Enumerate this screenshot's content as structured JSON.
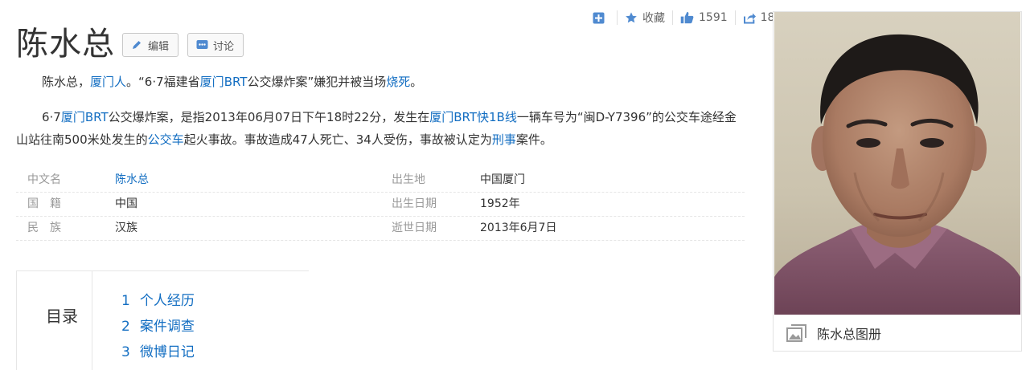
{
  "toolbar": {
    "add_label": "",
    "favorite_label": "收藏",
    "like_count": "1591",
    "share_count": "18"
  },
  "title": "陈水总",
  "buttons": {
    "edit": "编辑",
    "discuss": "讨论"
  },
  "summary": {
    "s1": "陈水总，",
    "l1": "厦门人",
    "s2": "。“6·7福建省",
    "l2": "厦门",
    "l3": "BRT",
    "s3": "公交爆炸案”嫌犯并被当场",
    "l4": "烧死",
    "s4": "。"
  },
  "para2": {
    "s1": "6·7",
    "l1": "厦门",
    "l2": "BRT",
    "s2": "公交爆炸案，是指2013年06月07日下午18时22分，发生在",
    "l3": "厦门BRT快1B线",
    "s3": "一辆车号为“闽D-Y7396”的公交车途经金山站往南500米处发生的",
    "l4": "公交车",
    "s4": "起火事故。事故造成47人死亡、34人受伤，事故被认定为",
    "l5": "刑事",
    "s5": "案件。"
  },
  "info": [
    {
      "label": "中文名",
      "value": "陈水总",
      "label2": "出生地",
      "value2": "中国厦门"
    },
    {
      "label": "国　籍",
      "value": "中国",
      "label2": "出生日期",
      "value2": "1952年"
    },
    {
      "label": "民　族",
      "value": "汉族",
      "label2": "逝世日期",
      "value2": "2013年6月7日"
    }
  ],
  "catalog": {
    "title": "目录",
    "items": [
      {
        "num": "1",
        "label": "个人经历"
      },
      {
        "num": "2",
        "label": "案件调查"
      },
      {
        "num": "3",
        "label": "微博日记"
      }
    ]
  },
  "album_label": "陈水总图册",
  "colors": {
    "link": "#136ec2",
    "icon_blue": "#4f8ad0",
    "label_gray": "#999999"
  }
}
